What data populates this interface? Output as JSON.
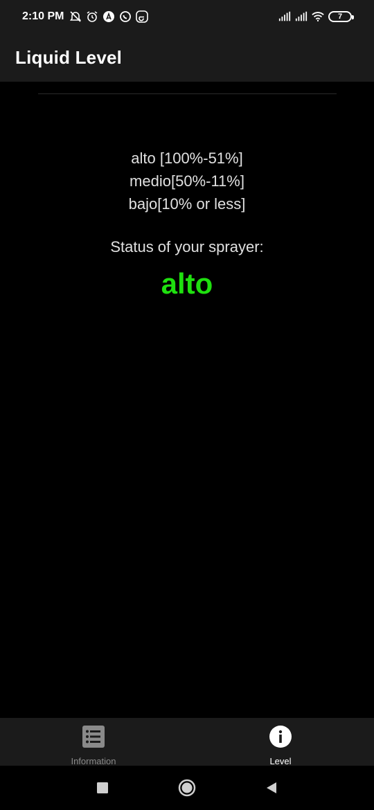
{
  "status_bar": {
    "time": "2:10 PM",
    "left_icons": [
      "alarm-off-icon",
      "alarm-clock-icon",
      "app-a-icon",
      "whatsapp-icon",
      "e-app-icon"
    ],
    "right_icons": [
      "signal-1-icon",
      "signal-2-icon",
      "wifi-icon"
    ],
    "battery": "7"
  },
  "app_bar": {
    "title": "Liquid Level"
  },
  "legend": {
    "line1": "alto [100%-51%]",
    "line2": "medio[50%-11%]",
    "line3": "bajo[10% or less]"
  },
  "status": {
    "label": "Status of your sprayer:",
    "value": "alto",
    "value_color": "#1fe00f"
  },
  "bottom_nav": {
    "items": [
      {
        "label": "Information",
        "icon": "list-icon",
        "active": false
      },
      {
        "label": "Level",
        "icon": "info-icon",
        "active": true
      }
    ]
  },
  "system_nav": [
    "recents-button",
    "home-button",
    "back-button"
  ]
}
